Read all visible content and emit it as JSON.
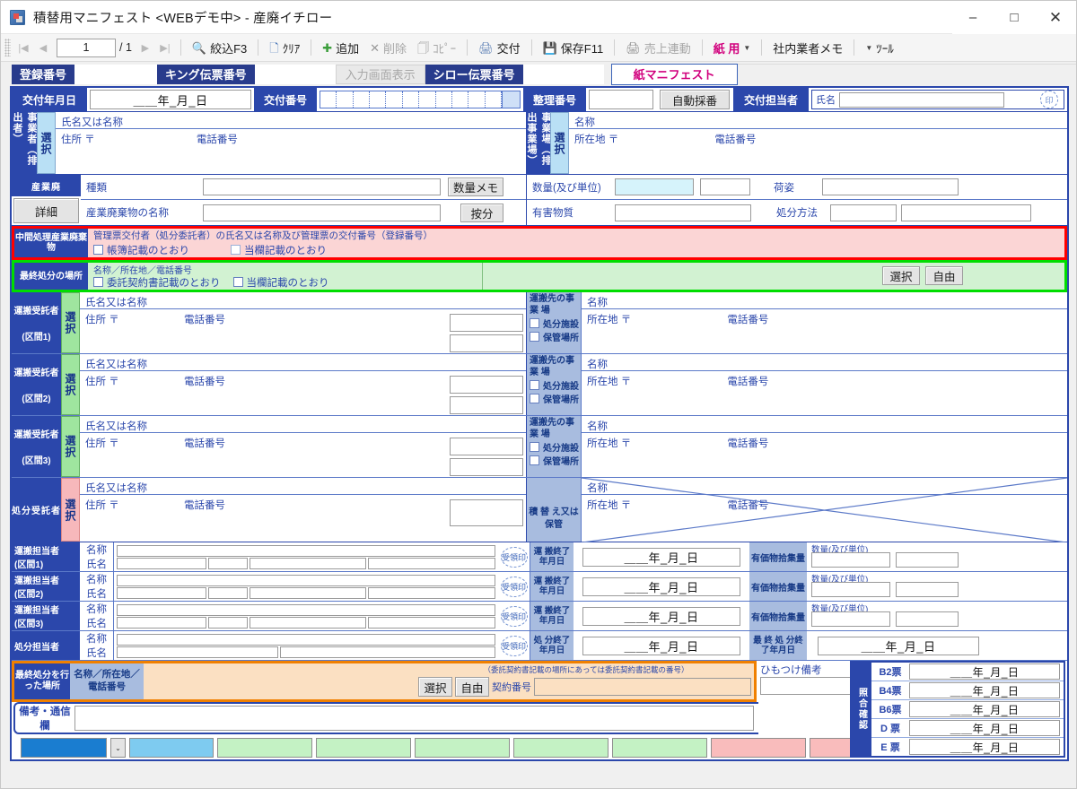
{
  "window": {
    "title": "積替用マニフェスト <WEBデモ中> - 産廃イチロー",
    "minimize": "–",
    "maximize": "□",
    "close": "✕"
  },
  "toolbar": {
    "first": "|◀",
    "prev": "◀",
    "page": "1",
    "page_total": "/ 1",
    "next": "▶",
    "last": "▶|",
    "filter": "絞込F3",
    "clear": "ｸﾘｱ",
    "add": "追加",
    "delete": "削除",
    "copy": "ｺﾋﾟｰ",
    "issue": "交付",
    "save": "保存F11",
    "sales_link": "売上連動",
    "paper_use": "紙 用",
    "memo": "社内業者メモ",
    "tools": "ﾂｰﾙ"
  },
  "tagbar": {
    "reg_no": "登録番号",
    "king_slip_no": "キング伝票番号",
    "input_screen": "入力画面表示",
    "shiro_slip_no": "シロー伝票番号",
    "tab_paper_manifest": "紙マニフェスト"
  },
  "header": {
    "issue_date_label": "交付年月日",
    "issue_date_value": "＿＿年_月_日",
    "issue_no_label": "交付番号",
    "seiri_no_label": "整理番号",
    "auto_number": "自動採番",
    "issue_staff_label": "交付担当者",
    "name_label": "氏名",
    "seal": "印"
  },
  "emitter": {
    "side_label": "事業者（排出者）",
    "select": "選択",
    "name_or_title": "氏名又は名称",
    "address": "住所  〒",
    "phone": "電話番号"
  },
  "emitter_site": {
    "side_label": "事業場（排出事業場）",
    "select": "選択",
    "name": "名称",
    "location": "所在地 〒",
    "phone": "電話番号"
  },
  "waste": {
    "side_label": "産業廃",
    "detail_button": "詳細",
    "type_label": "種類",
    "qty_memo_button": "数量メモ",
    "waste_name_label": "産業廃棄物の名称",
    "prorate_button": "按分",
    "qty_unit_label": "数量(及び単位)",
    "package_label": "荷姿",
    "hazard_label": "有害物質",
    "disposal_method_label": "処分方法"
  },
  "intermediate": {
    "side_label": "中間処理産業廃棄物",
    "note": "管理票交付者（処分委託者）の氏名又は名称及び管理票の交付番号（登録番号）",
    "check1": "帳簿記載のとおり",
    "check2": "当欄記載のとおり"
  },
  "final_place": {
    "side_label": "最終処分の場所",
    "note": "名称／所在地／電話番号",
    "check1": "委託契約書記載のとおり",
    "check2": "当欄記載のとおり",
    "select": "選択",
    "free": "自由"
  },
  "carriers": [
    {
      "side_label": "運搬受託者",
      "section": "(区間1)",
      "select": "選択",
      "name_or_title": "氏名又は名称",
      "address": "住所  〒",
      "phone": "電話番号",
      "dest_label": "運搬先の事 業 場",
      "chk_facility": "処分施設",
      "chk_storage": "保管場所",
      "dest_name": "名称",
      "dest_location": "所在地 〒",
      "dest_phone": "電話番号"
    },
    {
      "side_label": "運搬受託者",
      "section": "(区間2)",
      "select": "選択",
      "name_or_title": "氏名又は名称",
      "address": "住所  〒",
      "phone": "電話番号",
      "dest_label": "運搬先の事 業 場",
      "chk_facility": "処分施設",
      "chk_storage": "保管場所",
      "dest_name": "名称",
      "dest_location": "所在地 〒",
      "dest_phone": "電話番号"
    },
    {
      "side_label": "運搬受託者",
      "section": "(区間3)",
      "select": "選択",
      "name_or_title": "氏名又は名称",
      "address": "住所  〒",
      "phone": "電話番号",
      "dest_label": "運搬先の事 業 場",
      "chk_facility": "処分施設",
      "chk_storage": "保管場所",
      "dest_name": "名称",
      "dest_location": "所在地 〒",
      "dest_phone": "電話番号"
    }
  ],
  "disposer": {
    "side_label": "処分受託者",
    "select": "選択",
    "name_or_title": "氏名又は名称",
    "address": "住所  〒",
    "phone": "電話番号",
    "transfer_label": "積 替 え又は保管",
    "name": "名称",
    "location": "所在地 〒",
    "phone2": "電話番号"
  },
  "staff_rows": [
    {
      "side_label": "運搬担当者",
      "section": "(区間1)",
      "name_label": "名称",
      "person_label": "氏名",
      "seal": "受領印",
      "date_label": "運 搬終了年月日",
      "date_value": "＿＿年_月_日",
      "valuable_label": "有価物拾集量",
      "qty_label": "数量(及び単位)"
    },
    {
      "side_label": "運搬担当者",
      "section": "(区間2)",
      "name_label": "名称",
      "person_label": "氏名",
      "seal": "受領印",
      "date_label": "運 搬終了年月日",
      "date_value": "＿＿年_月_日",
      "valuable_label": "有価物拾集量",
      "qty_label": "数量(及び単位)"
    },
    {
      "side_label": "運搬担当者",
      "section": "(区間3)",
      "name_label": "名称",
      "person_label": "氏名",
      "seal": "受領印",
      "date_label": "運 搬終了年月日",
      "date_value": "＿＿年_月_日",
      "valuable_label": "有価物拾集量",
      "qty_label": "数量(及び単位)"
    }
  ],
  "disposal_staff": {
    "side_label": "処分担当者",
    "name_label": "名称",
    "person_label": "氏名",
    "seal": "受領印",
    "date_label": "処 分終了年月日",
    "date_value": "＿＿年_月_日",
    "final_date_label": "最 終 処 分終了年月日",
    "final_date_value": "＿＿年_月_日"
  },
  "final_disposal_place": {
    "side_label": "最終処分を行った場所",
    "field_label": "名称／所在地／電話番号",
    "note": "（委託契約書記載の場所にあっては委託契約書記載の番号）",
    "select": "選択",
    "free": "自由",
    "contract_no_label": "契約番号"
  },
  "himotsuke": {
    "label": "ひもつけ備考"
  },
  "remarks": {
    "label": "備考・通信欄"
  },
  "verify": {
    "side_label": "照合確認",
    "rows": [
      {
        "slip": "B2票",
        "date": "＿＿年_月_日"
      },
      {
        "slip": "B4票",
        "date": "＿＿年_月_日"
      },
      {
        "slip": "B6票",
        "date": "＿＿年_月_日"
      },
      {
        "slip": "D 票",
        "date": "＿＿年_月_日"
      },
      {
        "slip": "E 票",
        "date": "＿＿年_月_日"
      }
    ]
  },
  "statusbar": {
    "dropdown_arrow": "⌄"
  },
  "colors": {
    "header_blue": "#2b47ab",
    "accent_pink": "#d1007d",
    "band_red": "#ff0000",
    "band_green": "#00dd00",
    "band_orange": "#f08000",
    "select_blue": "#b9e0f5",
    "select_green": "#9fe59f",
    "select_pink": "#f7b8bb"
  }
}
